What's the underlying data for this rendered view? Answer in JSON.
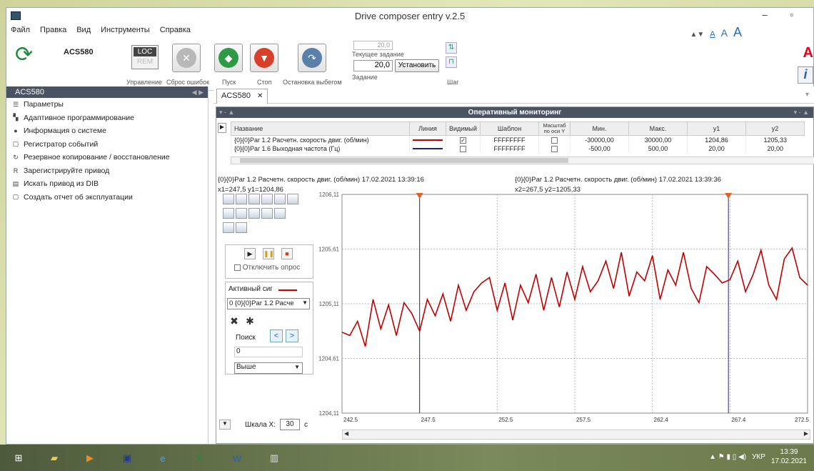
{
  "window": {
    "title": "Drive composer entry v.2.5",
    "controls": "– ▫"
  },
  "menu": [
    "Файл",
    "Правка",
    "Вид",
    "Инструменты",
    "Справка"
  ],
  "font_size": {
    "arrows": "▲▼",
    "a1": "A",
    "a2": "A",
    "a3": "A"
  },
  "toolbar": {
    "drive_name": "ACS580",
    "loc": "LOC",
    "rem": "REM",
    "captions": {
      "control": "Управление",
      "reset": "Сброс ошибок",
      "start": "Пуск",
      "stop": "Стоп",
      "coast": "Остановка выбегом",
      "setpoint": "Задание",
      "step": "Шаг"
    },
    "setpoint_top": "20,0",
    "current_setpoint_label": "Текущее задание",
    "setpoint_value": "20,0",
    "set_button": "Установить"
  },
  "sidebar": {
    "title": "ACS580",
    "nav": "◀ ▶",
    "items": [
      {
        "icon": "☰",
        "label": "Параметры"
      },
      {
        "icon": "▚",
        "label": "Адаптивное программирование"
      },
      {
        "icon": "●",
        "label": "Информация о системе"
      },
      {
        "icon": "▢",
        "label": "Регистратор событий"
      },
      {
        "icon": "↻",
        "label": "Резервное копирование / восстановление"
      },
      {
        "icon": "R",
        "label": "Зарегистрируйте привод"
      },
      {
        "icon": "▤",
        "label": "Искать привод из DIB"
      },
      {
        "icon": "▢",
        "label": "Создать отчет об эксплуатации"
      }
    ]
  },
  "tab": {
    "label": "ACS580",
    "close": "✕"
  },
  "monitor": {
    "title": "Оперативный мониторинг",
    "columns": [
      "Название",
      "Линия",
      "Видимый",
      "Шаблон",
      "Масштаб по оси Y",
      "Мин.",
      "Макс.",
      "y1",
      "y2"
    ],
    "rows": [
      {
        "name": "{0}{0}Par 1.2 Расчетн. скорость двиг. (об/мин)",
        "color": "#c00000",
        "visible": "✓",
        "pattern": "FFFFFFFF",
        "scale": "",
        "min": "-30000,00",
        "max": "30000,00",
        "y1": "1204,86",
        "y2": "1205,33"
      },
      {
        "name": "{0}{0}Par 1.6 Выходная частота (Гц)",
        "color": "#1a237e",
        "visible": "",
        "pattern": "FFFFFFFF",
        "scale": "",
        "min": "-500,00",
        "max": "500,00",
        "y1": "20,00",
        "y2": "20,00"
      }
    ],
    "cursor1_line1": "{0}{0}Par 1.2 Расчетн. скорость двиг. (об/мин) 17.02.2021 13:39:16",
    "cursor1_line2": "x1=247,5 y1=1204,86",
    "cursor2_line1": "{0}{0}Par 1.2 Расчетн. скорость двиг. (об/мин) 17.02.2021 13:39:36",
    "cursor2_line2": "x2=267,5 y2=1205,33",
    "disable_poll": "Отключить опрос",
    "active_signal": "Активный сиг",
    "active_signal_value": "0 {0}{0}Par 1.2 Расче",
    "search_label": "Поиск",
    "search_value": "0",
    "direction": "Выше",
    "scale_x_label": "Шкала X:",
    "scale_x_value": "30",
    "scale_x_unit": "с"
  },
  "chart_data": {
    "type": "line",
    "x_ticks": [
      "242.5",
      "247.5",
      "252.5",
      "257.5",
      "262.4",
      "267.4",
      "272.5"
    ],
    "y_ticks": [
      "1206,11",
      "1205,61",
      "1205,11",
      "1204,61",
      "1204,11"
    ],
    "ylim": [
      1204.11,
      1206.11
    ],
    "xlim": [
      242.5,
      272.5
    ],
    "cursors": [
      247.5,
      267.4
    ],
    "series": [
      {
        "color": "#c00000",
        "x": [
          242.5,
          243.0,
          243.5,
          244.0,
          244.5,
          245.0,
          245.5,
          246.0,
          246.5,
          247.0,
          247.5,
          248.0,
          248.5,
          249.0,
          249.5,
          250.0,
          250.5,
          251.0,
          251.5,
          252.0,
          252.5,
          253.0,
          253.5,
          254.0,
          254.5,
          255.0,
          255.5,
          256.0,
          256.5,
          257.0,
          257.5,
          258.0,
          258.5,
          259.0,
          259.5,
          260.0,
          260.5,
          261.0,
          261.5,
          262.0,
          262.5,
          263.0,
          263.5,
          264.0,
          264.5,
          265.0,
          265.5,
          266.0,
          266.5,
          267.0,
          267.5,
          268.0,
          268.5,
          269.0,
          269.5,
          270.0,
          270.5,
          271.0,
          271.5,
          272.0,
          272.5
        ],
        "y": [
          1204.85,
          1204.82,
          1204.95,
          1204.72,
          1205.15,
          1204.88,
          1205.1,
          1204.82,
          1205.12,
          1205.02,
          1204.86,
          1205.15,
          1205.0,
          1205.2,
          1204.95,
          1205.28,
          1205.05,
          1205.22,
          1205.3,
          1205.35,
          1205.05,
          1205.3,
          1204.96,
          1205.28,
          1205.12,
          1205.38,
          1205.05,
          1205.35,
          1205.08,
          1205.4,
          1205.15,
          1205.45,
          1205.22,
          1205.32,
          1205.5,
          1205.25,
          1205.58,
          1205.18,
          1205.4,
          1205.32,
          1205.55,
          1205.15,
          1205.42,
          1205.28,
          1205.58,
          1205.25,
          1205.12,
          1205.45,
          1205.38,
          1205.3,
          1205.33,
          1205.5,
          1205.22,
          1205.38,
          1205.6,
          1205.28,
          1205.15,
          1205.52,
          1205.62,
          1205.35,
          1205.28
        ]
      }
    ]
  },
  "taskbar": {
    "lang": "УКР",
    "time": "13:39",
    "date": "17.02.2021"
  }
}
